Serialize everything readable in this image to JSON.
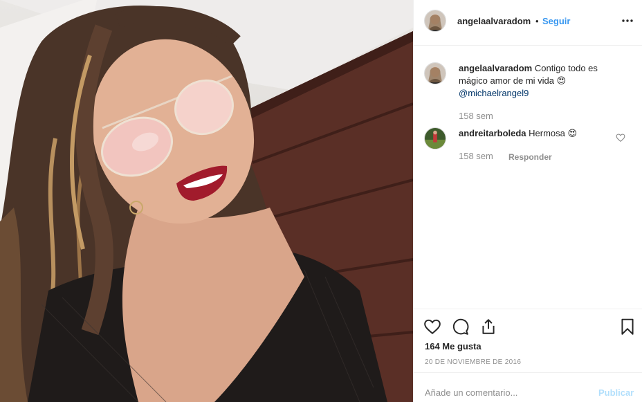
{
  "post": {
    "username": "angelaalvaradom",
    "separator": "•",
    "follow_label": "Seguir",
    "caption": {
      "username": "angelaalvaradom",
      "text": "Contigo todo es mágico amor de mi vida 😍",
      "mention": "@michaelrangel9",
      "time": "158 sem"
    },
    "comments": [
      {
        "username": "andreitarboleda",
        "text": "Hermosa 😍",
        "time": "158 sem",
        "reply_label": "Responder"
      }
    ],
    "likes": "164 Me gusta",
    "date": "20 DE NOVIEMBRE DE 2016",
    "comment_placeholder": "Añade un comentario...",
    "publish_label": "Publicar"
  },
  "icons": {
    "more": "more-options-icon",
    "like": "heart-icon",
    "comment": "comment-icon",
    "share": "share-icon",
    "save": "bookmark-icon"
  },
  "colors": {
    "link": "#3897f0",
    "mention": "#003569",
    "muted": "#8e8e8e",
    "publish_disabled": "#b2dffc"
  }
}
